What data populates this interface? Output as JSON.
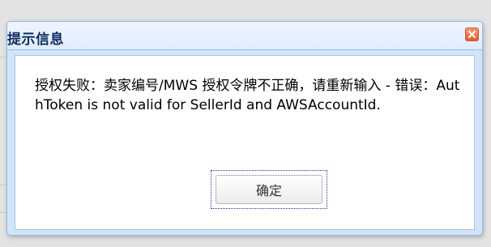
{
  "dialog": {
    "title": "提示信息",
    "close_icon": "close-icon",
    "message": "授权失败：卖家编号/MWS 授权令牌不正确，请重新输入 - 错误：AuthToken is not valid for SellerId and AWSAccountId.",
    "ok_label": "确定"
  },
  "colors": {
    "title_text": "#0e2d5f",
    "dialog_border": "#95b8e7",
    "close_button": "#e2592f"
  }
}
